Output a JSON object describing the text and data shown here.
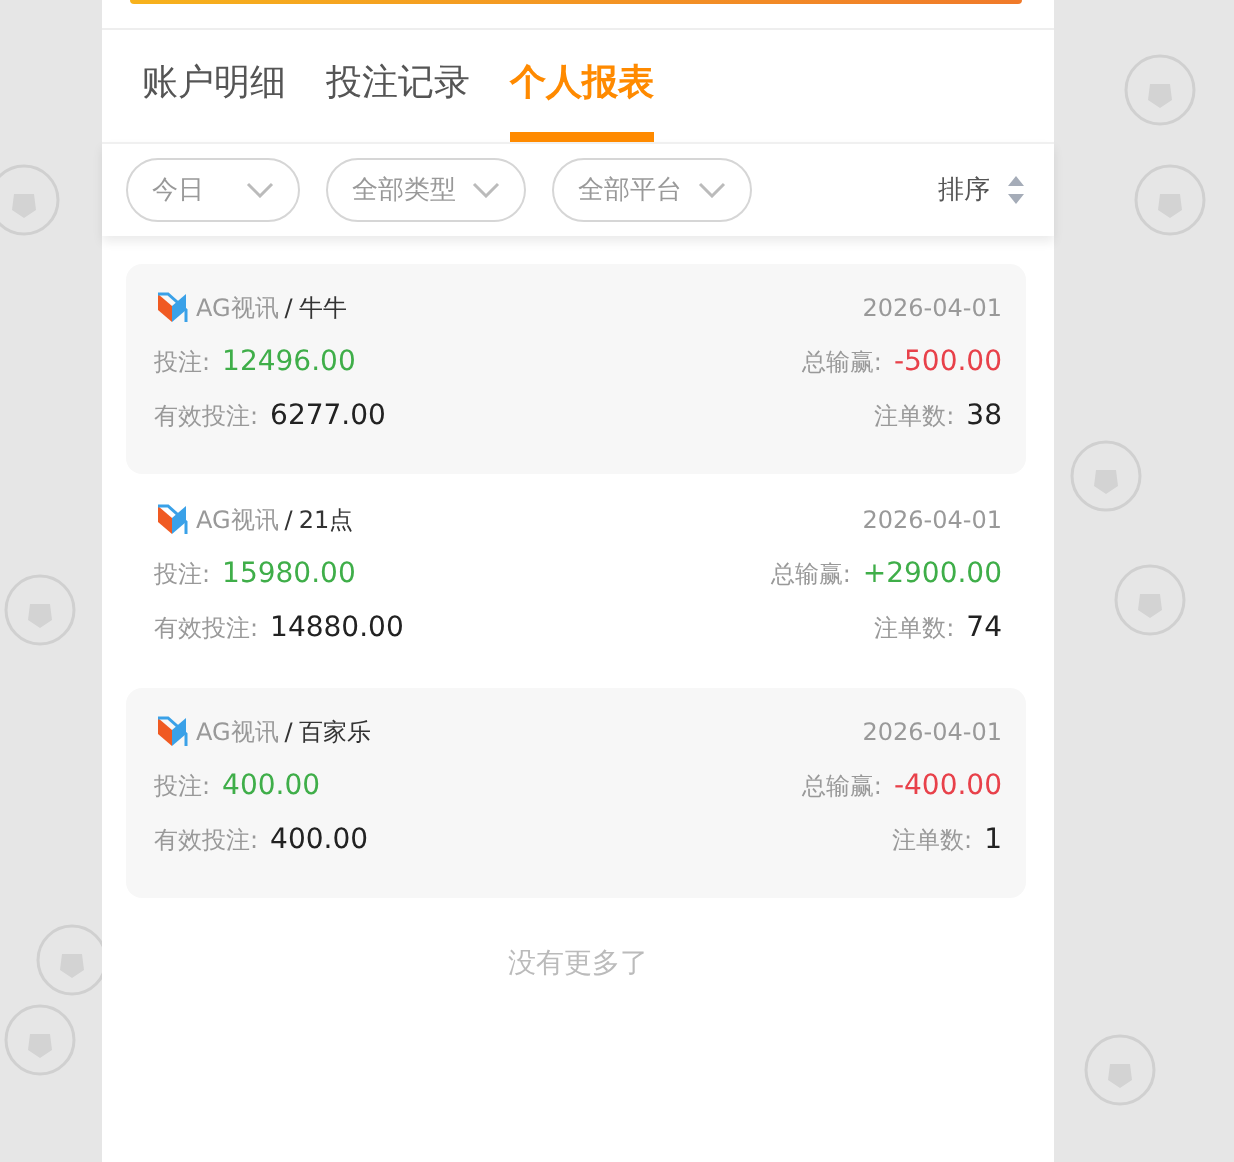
{
  "tabs": [
    {
      "label": "账户明细",
      "selected": false
    },
    {
      "label": "投注记录",
      "selected": false
    },
    {
      "label": "个人报表",
      "selected": true
    }
  ],
  "filters": [
    {
      "label": "今日"
    },
    {
      "label": "全部类型"
    },
    {
      "label": "全部平台"
    }
  ],
  "sort": {
    "label": "排序"
  },
  "records": [
    {
      "platform": "AG视讯",
      "separator": "/",
      "game": "牛牛",
      "date": "2026-04-01",
      "bet_label": "投注:",
      "bet": "12496.00",
      "win_label": "总输赢:",
      "win": "-500.00",
      "kind": "loss",
      "valid_label": "有效投注:",
      "valid": "6277.00",
      "count_label": "注单数:",
      "count": "38"
    },
    {
      "platform": "AG视讯",
      "separator": "/",
      "game": "21点",
      "date": "2026-04-01",
      "bet_label": "投注:",
      "bet": "15980.00",
      "win_label": "总输赢:",
      "win": "+2900.00",
      "kind": "gain",
      "valid_label": "有效投注:",
      "valid": "14880.00",
      "count_label": "注单数:",
      "count": "74"
    },
    {
      "platform": "AG视讯",
      "separator": "/",
      "game": "百家乐",
      "date": "2026-04-01",
      "bet_label": "投注:",
      "bet": "400.00",
      "win_label": "总输赢:",
      "win": "-400.00",
      "kind": "loss",
      "valid_label": "有效投注:",
      "valid": "400.00",
      "count_label": "注单数:",
      "count": "1"
    }
  ],
  "footer": "没有更多了"
}
